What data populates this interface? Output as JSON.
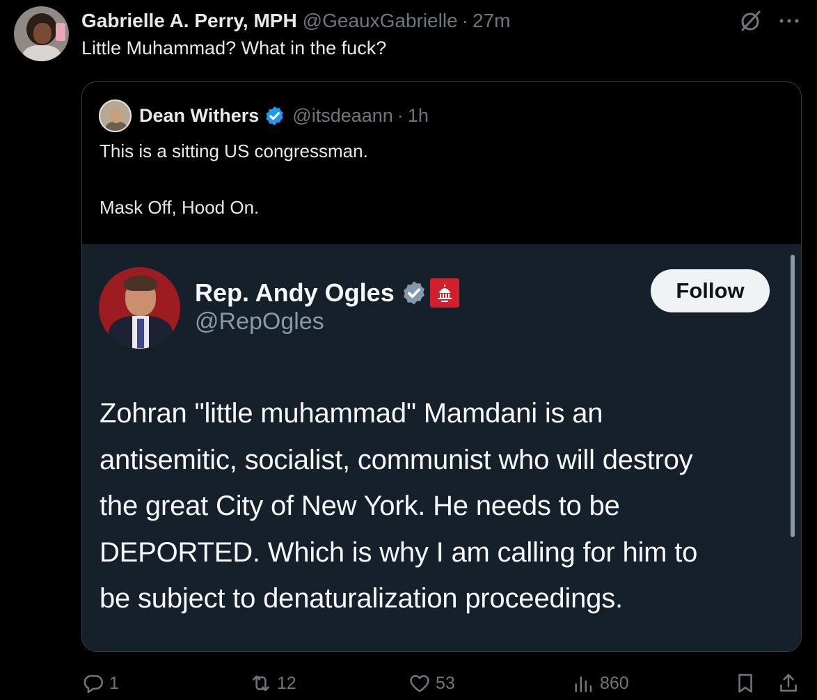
{
  "tweet": {
    "author": {
      "name": "Gabrielle A. Perry, MPH",
      "handle": "@GeauxGabrielle",
      "time": "27m"
    },
    "text": "Little Muhammad? What in the fuck?",
    "icons": {
      "grok": "grok-icon",
      "more": "more-icon"
    },
    "quote": {
      "author": {
        "name": "Dean Withers",
        "handle": "@itsdeaann",
        "time": "1h",
        "verified": "blue"
      },
      "text_lines": [
        "This is a sitting US congressman.",
        "Mask Off, Hood On."
      ],
      "embed": {
        "name": "Rep. Andy Ogles",
        "handle": "@RepOgles",
        "verified": "grey",
        "affiliation_badge": "gop-capitol-badge",
        "follow_label": "Follow",
        "body_lines": [
          "Zohran \"little muhammad\" Mamdani is an",
          "antisemitic, socialist, communist who will destroy",
          "the great City of New York. He needs to be",
          "DEPORTED. Which is why I am calling for him to",
          "be subject to denaturalization proceedings."
        ]
      }
    },
    "actions": {
      "replies": "1",
      "reposts": "12",
      "likes": "53",
      "views": "860",
      "bookmark_icon": "bookmark-icon",
      "share_icon": "share-icon"
    }
  },
  "colors": {
    "background": "#000000",
    "text": "#e7e9ea",
    "muted": "#71767b",
    "embed_background": "#15202b",
    "verified_blue": "#1d9bf0",
    "gov_red": "#d11f2e"
  }
}
